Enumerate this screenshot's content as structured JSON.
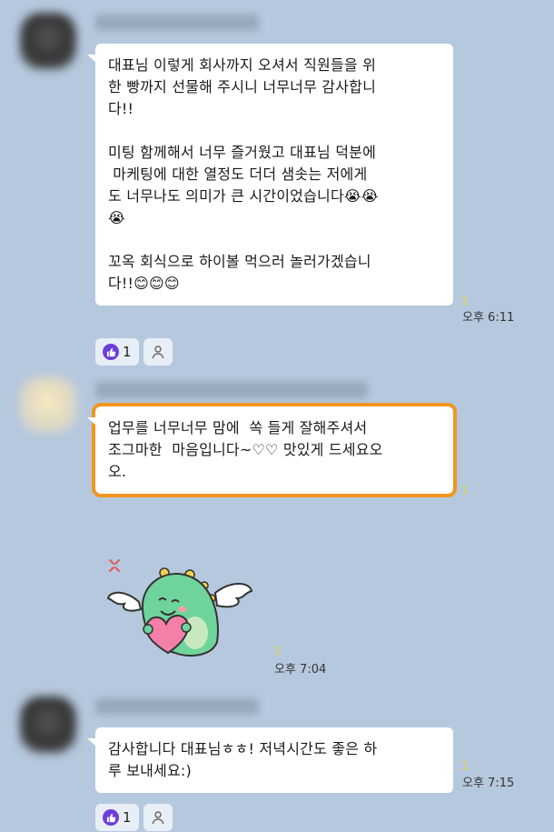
{
  "messages": [
    {
      "text": "대표님 이렇게 회사까지 오셔서 직원들을 위\n한 빵까지 선물해 주시니 너무너무 감사합니\n다!!\n\n미팅 함께해서 너무 즐거웠고 대표님 덕분에\n 마케팅에 대한 열정도 더더 샘솟는 저에게\n도 너무나도 의미가 큰 시간이었습니다😭😭\n😭\n\n꼬옥 회식으로 하이볼 먹으러 놀러가겠습니\n다!!😊😊😊",
      "read_count": "1",
      "time": "오후 6:11",
      "reaction_count": "1"
    },
    {
      "text": "업무를 너무너무 맘에  쏙 들게 잘해주셔서\n조그마한  마음입니다~♡♡ 맛있게 드세요오\n오.",
      "read_count": "1"
    },
    {
      "sticker": "dinosaur-heart-sticker",
      "read_count": "1",
      "time": "오후 7:04"
    },
    {
      "text": "감사합니다 대표님ㅎㅎ! 저녁시간도 좋은 하\n루 보내세요:)",
      "read_count": "1",
      "time": "오후 7:15",
      "reaction_count": "1"
    }
  ],
  "colors": {
    "background": "#b6c8dd",
    "bubble": "#ffffff",
    "highlight": "#f0961f",
    "read_count": "#e8d63d",
    "reaction": "#6c3fd8"
  }
}
